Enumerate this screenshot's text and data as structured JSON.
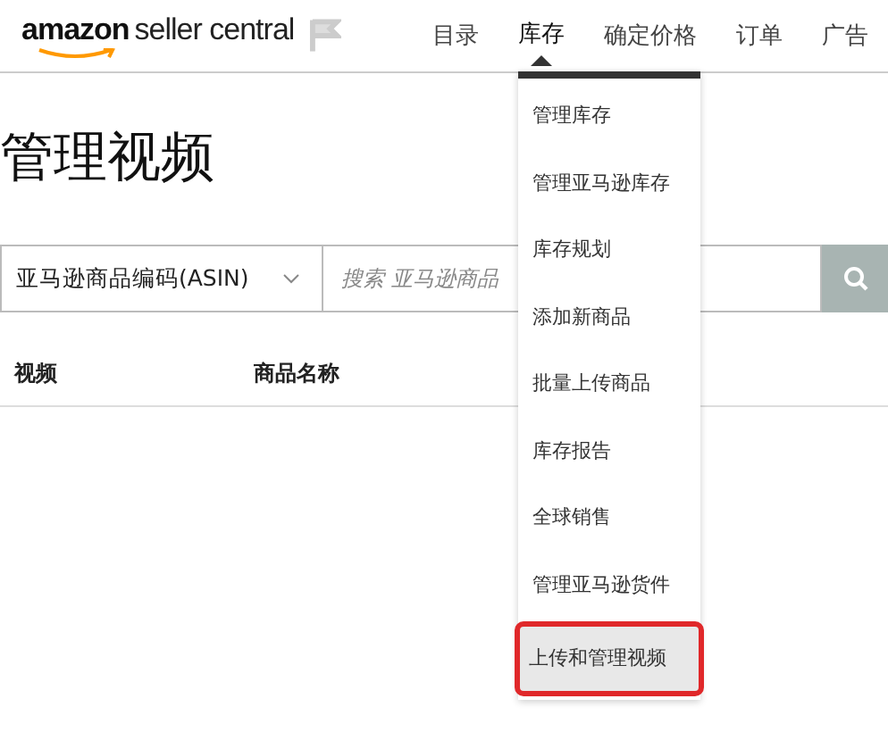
{
  "header": {
    "logo_brand": "amazon",
    "logo_product": "seller central",
    "nav": [
      {
        "label": "目录",
        "selected": false
      },
      {
        "label": "库存",
        "selected": true
      },
      {
        "label": "确定价格",
        "selected": false
      },
      {
        "label": "订单",
        "selected": false
      },
      {
        "label": "广告",
        "selected": false
      }
    ]
  },
  "page_title": "管理视频",
  "search": {
    "filter": "亚马逊商品编码(ASIN)",
    "placeholder": "搜索 亚马逊商品"
  },
  "table": {
    "columns": [
      "视频",
      "商品名称"
    ]
  },
  "menu": [
    {
      "label": "管理库存",
      "selected": false
    },
    {
      "label": "管理亚马逊库存",
      "selected": false
    },
    {
      "label": "库存规划",
      "selected": false
    },
    {
      "label": "添加新商品",
      "selected": false
    },
    {
      "label": "批量上传商品",
      "selected": false
    },
    {
      "label": "库存报告",
      "selected": false
    },
    {
      "label": "全球销售",
      "selected": false
    },
    {
      "label": "管理亚马逊货件",
      "selected": false
    },
    {
      "label": "上传和管理视频",
      "selected": true
    }
  ]
}
